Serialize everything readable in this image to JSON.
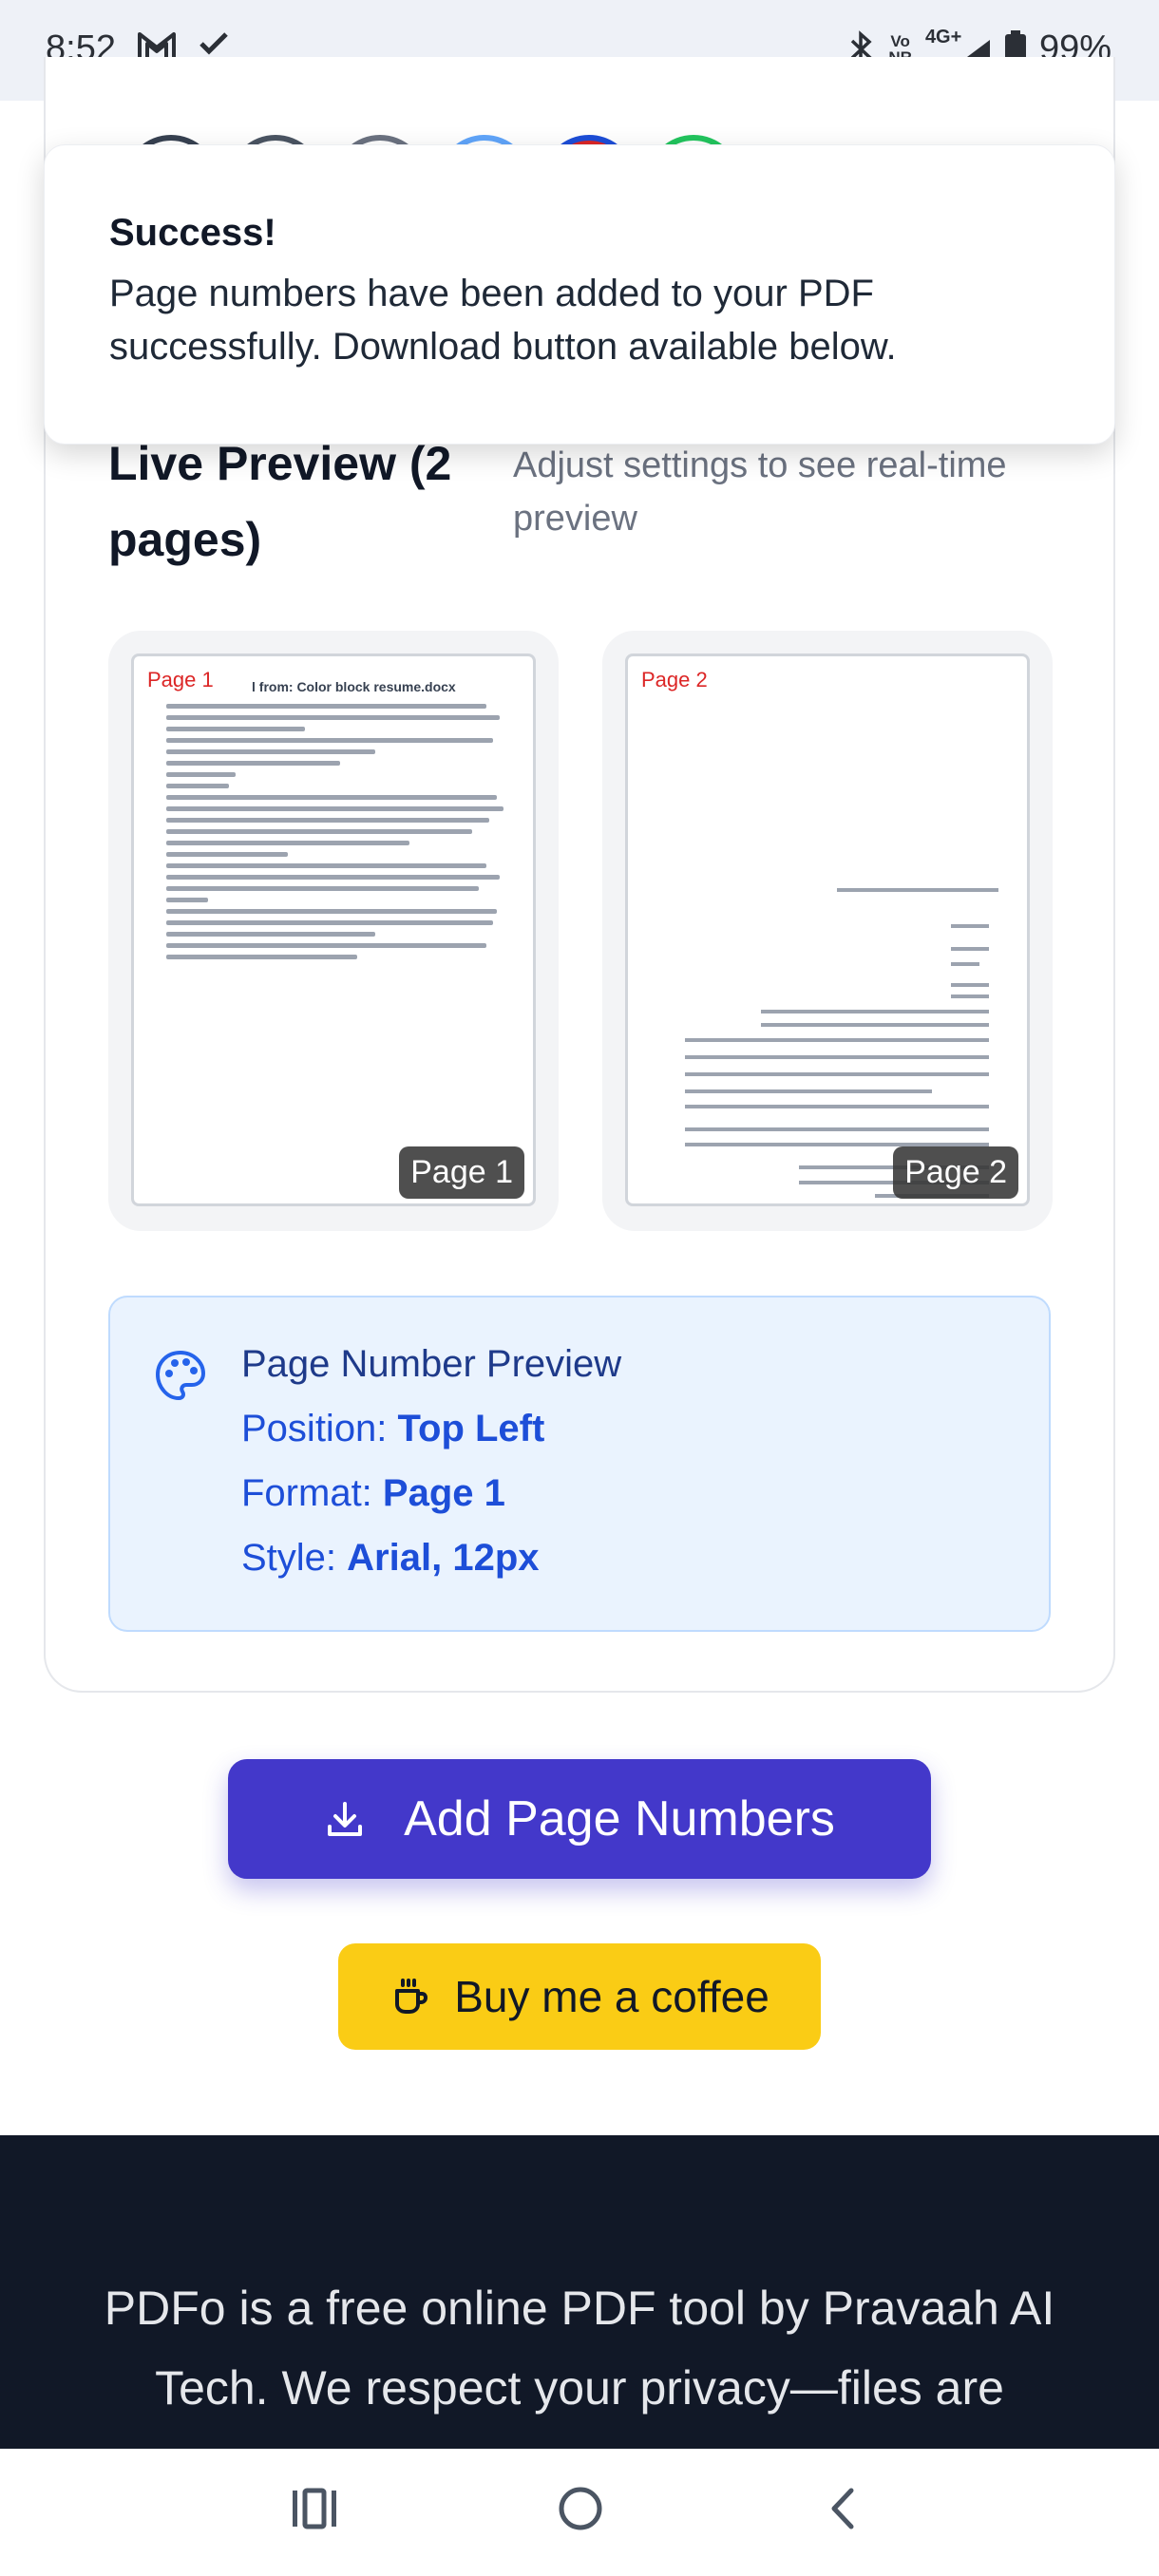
{
  "status_bar": {
    "time": "8:52",
    "network_line1": "Vo",
    "network_line2": "NR",
    "network_type": "4G+",
    "battery": "99%"
  },
  "toast": {
    "title": "Success!",
    "message": "Page numbers have been added to your PDF successfully. Download button available below."
  },
  "preview": {
    "title": "Live Preview (2 pages)",
    "hint": "Adjust settings to see real-time preview",
    "pages": [
      {
        "marker": "Page 1",
        "badge": "Page 1",
        "header_text": "l from: Color block resume.docx"
      },
      {
        "marker": "Page 2",
        "badge": "Page 2"
      }
    ]
  },
  "page_number_preview": {
    "title": "Page Number Preview",
    "position_label": "Position:",
    "position_value": "Top Left",
    "format_label": "Format:",
    "format_value": "Page 1",
    "style_label": "Style:",
    "style_value": "Arial, 12px",
    "icon": "palette-icon"
  },
  "actions": {
    "add_label": "Add Page Numbers",
    "add_icon": "download-icon",
    "coffee_label": "Buy me a coffee",
    "coffee_icon": "coffee-cup-icon"
  },
  "footer": {
    "text": "PDFo is a free online PDF tool by Pravaah AI Tech. We respect your privacy—files are processed securely and automatically deleted"
  },
  "colors": {
    "primary": "#4338ca",
    "coffee": "#facc15",
    "footer_bg": "#111827",
    "info_bg": "#eaf3fe",
    "page_marker": "#dc2626"
  }
}
